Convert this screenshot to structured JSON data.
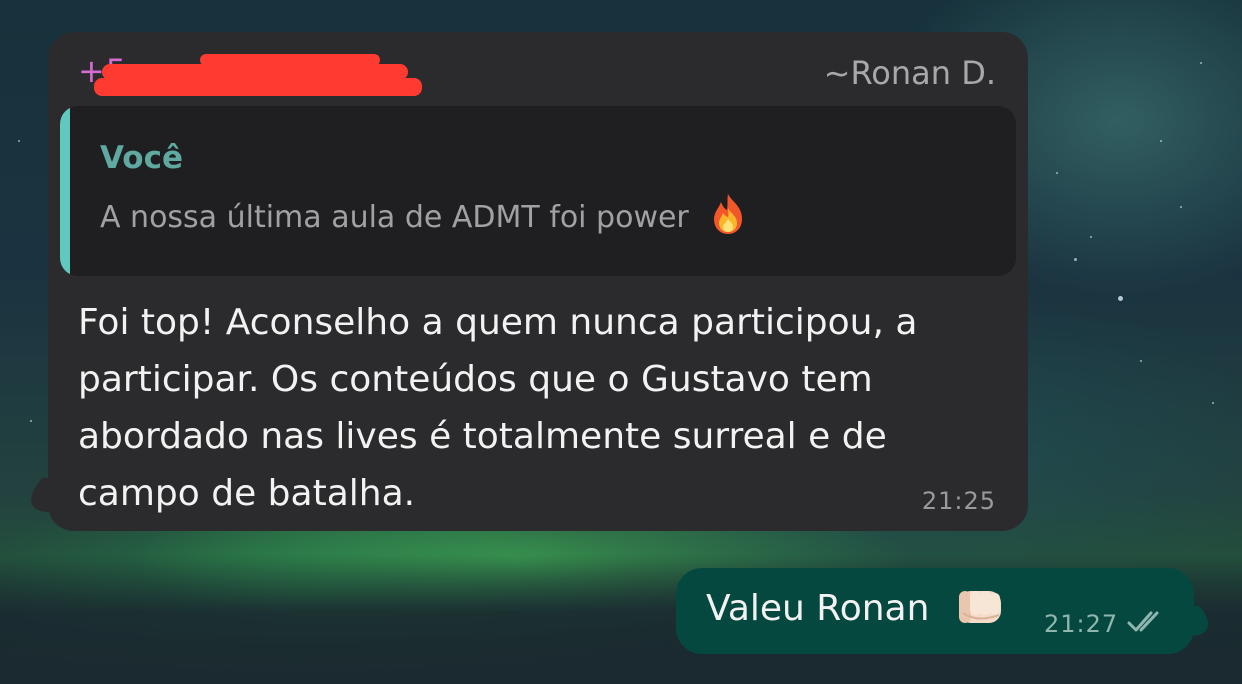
{
  "incoming_message": {
    "sender_phone": "+5•••••••••91",
    "sender_name": "~Ronan D.",
    "quoted": {
      "author": "Você",
      "text": "A nossa última aula de ADMT foi power",
      "emoji": "fire-emoji"
    },
    "text": "Foi top! Aconselho a quem nunca participou, a participar. Os conteúdos que o Gustavo tem abordado nas lives é totalmente surreal e de campo de batalha.",
    "time": "21:25"
  },
  "outgoing_message": {
    "text": "Valeu Ronan",
    "emoji": "fist-bump-emoji",
    "time": "21:27",
    "status_icon": "double-check-icon"
  },
  "colors": {
    "incoming_bubble": "#2b2b2d",
    "outgoing_bubble": "#05483f",
    "quote_bar": "#5fc9bd",
    "sender_phone": "#d66cd3",
    "redaction": "#ff3a30"
  }
}
